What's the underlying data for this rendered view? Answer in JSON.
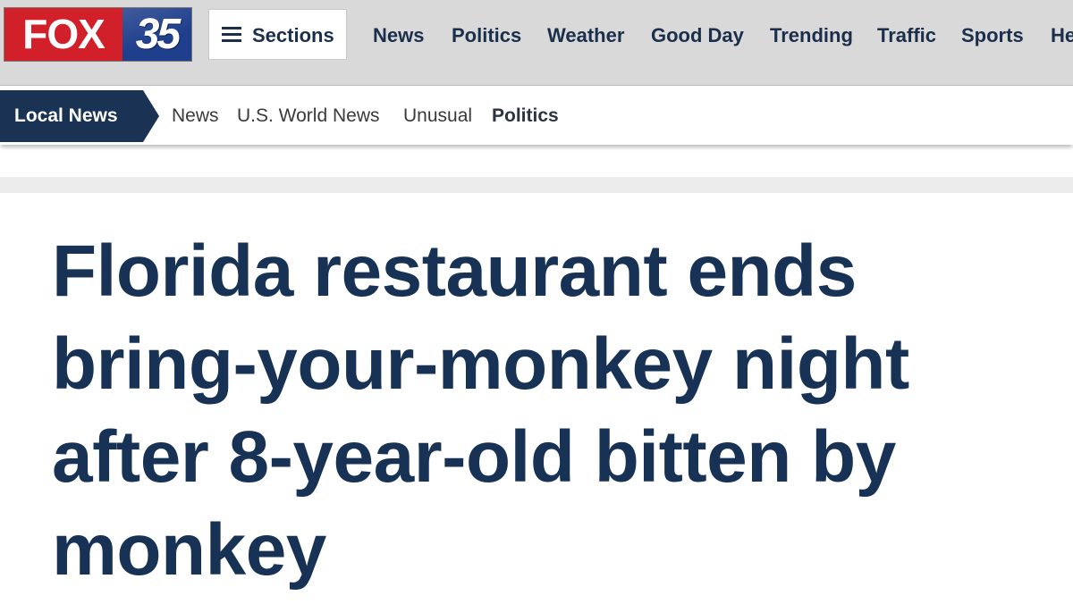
{
  "brand": {
    "logo_word": "FOX",
    "logo_number": "35",
    "logo_red": "#d2202a",
    "logo_blue": "#1f3f8c"
  },
  "header": {
    "sections_label": "Sections",
    "nav": [
      "News",
      "Politics",
      "Weather",
      "Good Day",
      "Trending",
      "Traffic",
      "Sports",
      "He"
    ]
  },
  "subnav": {
    "title": "Local News",
    "links": [
      "News",
      "U.S. World News",
      "Unusual",
      "Politics"
    ],
    "active": "Politics"
  },
  "article": {
    "headline": "Florida restaurant ends bring-your-monkey night after 8-year-old bitten by monkey"
  },
  "colors": {
    "navy": "#173255",
    "header_bg": "#d9d9d9",
    "subnav_tab": "#1a3254"
  },
  "icons": {
    "sections_button": "hamburger-icon"
  }
}
